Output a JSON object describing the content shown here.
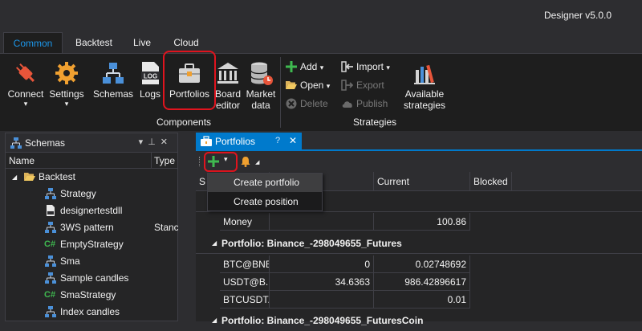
{
  "app": {
    "title": "Designer v5.0.0"
  },
  "ribbon_tabs": [
    "Common",
    "Backtest",
    "Live",
    "Cloud"
  ],
  "ribbon": {
    "components": {
      "connect": "Connect",
      "settings": "Settings",
      "schemas": "Schemas",
      "logs": "Logs",
      "portfolios": "Portfolios",
      "board_editor_1": "Board",
      "board_editor_2": "editor",
      "market_data_1": "Market",
      "market_data_2": "data",
      "group_label": "Components"
    },
    "strategies": {
      "add": "Add",
      "open": "Open",
      "delete": "Delete",
      "import": "Import",
      "export": "Export",
      "publish": "Publish",
      "available_1": "Available",
      "available_2": "strategies",
      "group_label": "Strategies"
    }
  },
  "schemas_panel": {
    "title": "Schemas",
    "col_name": "Name",
    "col_type": "Type",
    "items": [
      {
        "label": "Backtest",
        "type": "",
        "icon": "folder-open-icon"
      },
      {
        "label": "Strategy",
        "type": "",
        "icon": "schema-icon"
      },
      {
        "label": "designertestdll",
        "type": "",
        "icon": "dll-icon"
      },
      {
        "label": "3WS pattern",
        "type": "Stanc",
        "icon": "schema-icon"
      },
      {
        "label": "EmptyStrategy",
        "type": "",
        "icon": "csharp-icon"
      },
      {
        "label": "Sma",
        "type": "",
        "icon": "schema-icon"
      },
      {
        "label": "Sample candles",
        "type": "",
        "icon": "schema-icon"
      },
      {
        "label": "SmaStrategy",
        "type": "",
        "icon": "csharp-icon"
      },
      {
        "label": "Index candles",
        "type": "",
        "icon": "schema-icon"
      }
    ]
  },
  "doc_tab": {
    "label": "Portfolios"
  },
  "grid": {
    "columns": [
      "S",
      "Current",
      "Blocked"
    ],
    "money_row": {
      "name": "Money",
      "begin": "",
      "current": "100.86"
    },
    "groups": [
      {
        "title": "Portfolio: Binance_-298049655_Futures",
        "rows": [
          {
            "name": "BTC@BNB",
            "begin": "0",
            "current": "0.02748692"
          },
          {
            "name": "USDT@B...",
            "begin": "34.6363",
            "current": "986.42896617"
          },
          {
            "name": "BTCUSDT...",
            "begin": "",
            "current": "0.01"
          }
        ]
      },
      {
        "title": "Portfolio: Binance_-298049655_FuturesCoin",
        "rows": []
      }
    ]
  },
  "dropdown": {
    "items": [
      "Create portfolio",
      "Create position"
    ]
  },
  "colors": {
    "accent": "#007acc",
    "highlight": "#e0141e",
    "add_green": "#3fb950"
  }
}
